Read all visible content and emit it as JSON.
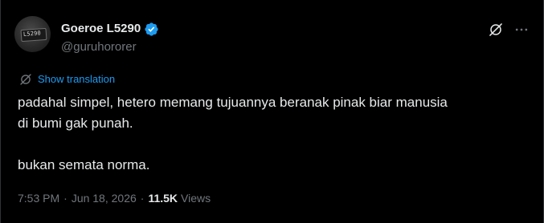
{
  "author": {
    "display_name": "Goeroe L5290",
    "handle": "@guruhororer",
    "verified": true,
    "avatar_plate_text": "L5290"
  },
  "actions": {
    "grok_icon": "grok-icon",
    "more_icon": "more-icon"
  },
  "translation": {
    "label": "Show translation",
    "icon": "translate-icon"
  },
  "tweet": {
    "lines": [
      "padahal simpel, hetero memang tujuannya beranak pinak biar manusia",
      "di bumi gak punah.",
      "",
      "bukan semata norma."
    ]
  },
  "meta": {
    "time": "7:53 PM",
    "separator": "·",
    "date": "Jun 18, 2026",
    "views_count": "11.5K",
    "views_label": "Views"
  },
  "colors": {
    "background": "#000000",
    "text_primary": "#e7e9ea",
    "text_secondary": "#71767b",
    "accent": "#1d9bf0"
  }
}
